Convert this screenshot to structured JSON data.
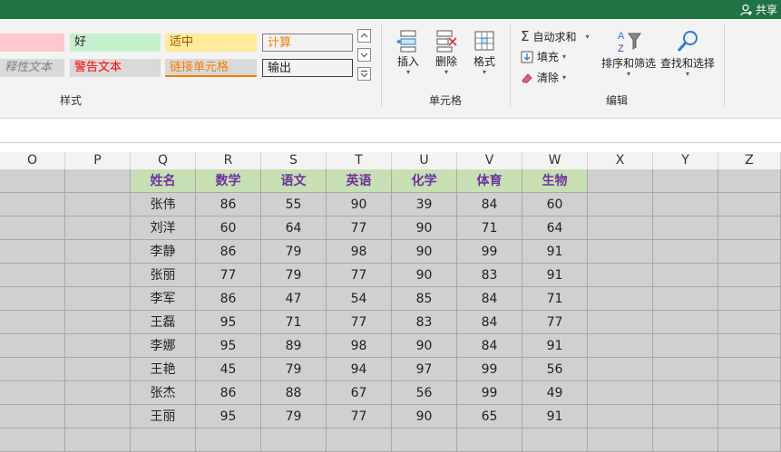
{
  "titlebar": {
    "share_label": "共享"
  },
  "styles": {
    "row1": [
      "",
      "好",
      "适中",
      "计算"
    ],
    "row2": [
      "释性文本",
      "警告文本",
      "链接单元格",
      "输出"
    ]
  },
  "cells_group": {
    "insert": "插入",
    "delete": "删除",
    "format": "格式"
  },
  "editing_group": {
    "autosum": "自动求和",
    "fill": "填充",
    "clear": "清除",
    "sort_filter": "排序和筛选",
    "find_select": "查找和选择"
  },
  "group_labels": {
    "styles": "样式",
    "cells": "单元格",
    "editing": "编辑"
  },
  "columns": [
    "O",
    "P",
    "Q",
    "R",
    "S",
    "T",
    "U",
    "V",
    "W",
    "X",
    "Y",
    "Z"
  ],
  "table": {
    "headers": [
      "姓名",
      "数学",
      "语文",
      "英语",
      "化学",
      "体育",
      "生物"
    ],
    "rows": [
      [
        "张伟",
        "86",
        "55",
        "90",
        "39",
        "84",
        "60"
      ],
      [
        "刘洋",
        "60",
        "64",
        "77",
        "90",
        "71",
        "64"
      ],
      [
        "李静",
        "86",
        "79",
        "98",
        "90",
        "99",
        "91"
      ],
      [
        "张丽",
        "77",
        "79",
        "77",
        "90",
        "83",
        "91"
      ],
      [
        "李军",
        "86",
        "47",
        "54",
        "85",
        "84",
        "71"
      ],
      [
        "王磊",
        "95",
        "71",
        "77",
        "83",
        "84",
        "77"
      ],
      [
        "李娜",
        "95",
        "89",
        "98",
        "90",
        "84",
        "91"
      ],
      [
        "王艳",
        "45",
        "79",
        "94",
        "97",
        "99",
        "56"
      ],
      [
        "张杰",
        "86",
        "88",
        "67",
        "56",
        "99",
        "49"
      ],
      [
        "王丽",
        "95",
        "79",
        "77",
        "90",
        "65",
        "91"
      ]
    ]
  },
  "colors": {
    "titlebar": "#217346",
    "header_fill": "#c6e0b4",
    "header_text": "#7030a0",
    "grid_fill": "#d0d0d0"
  }
}
